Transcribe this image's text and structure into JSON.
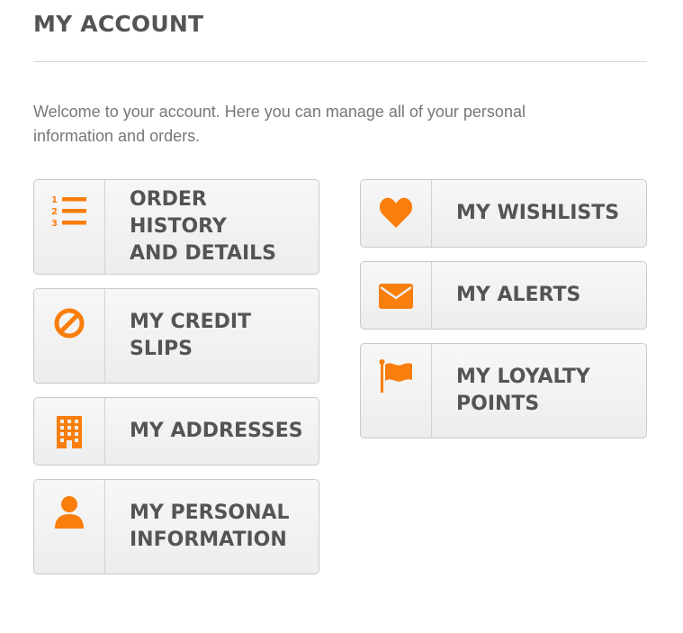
{
  "header": {
    "title": "MY ACCOUNT"
  },
  "intro": {
    "text": "Welcome to your account. Here you can manage all of your personal information and orders."
  },
  "colors": {
    "accent": "#f97e0b",
    "text": "#555454",
    "muted": "#777777"
  },
  "menu": {
    "order_history": {
      "label": "ORDER HISTORY\nAND DETAILS",
      "icon": "list-ordered-icon"
    },
    "credit_slips": {
      "label": "MY CREDIT\nSLIPS",
      "icon": "ban-icon"
    },
    "addresses": {
      "label": "MY ADDRESSES",
      "icon": "building-icon"
    },
    "personal_info": {
      "label": "MY PERSONAL\nINFORMATION",
      "icon": "user-icon"
    },
    "wishlists": {
      "label": "MY WISHLISTS",
      "icon": "heart-icon"
    },
    "alerts": {
      "label": "MY ALERTS",
      "icon": "envelope-icon"
    },
    "loyalty": {
      "label": "MY LOYALTY\nPOINTS",
      "icon": "flag-icon"
    }
  }
}
